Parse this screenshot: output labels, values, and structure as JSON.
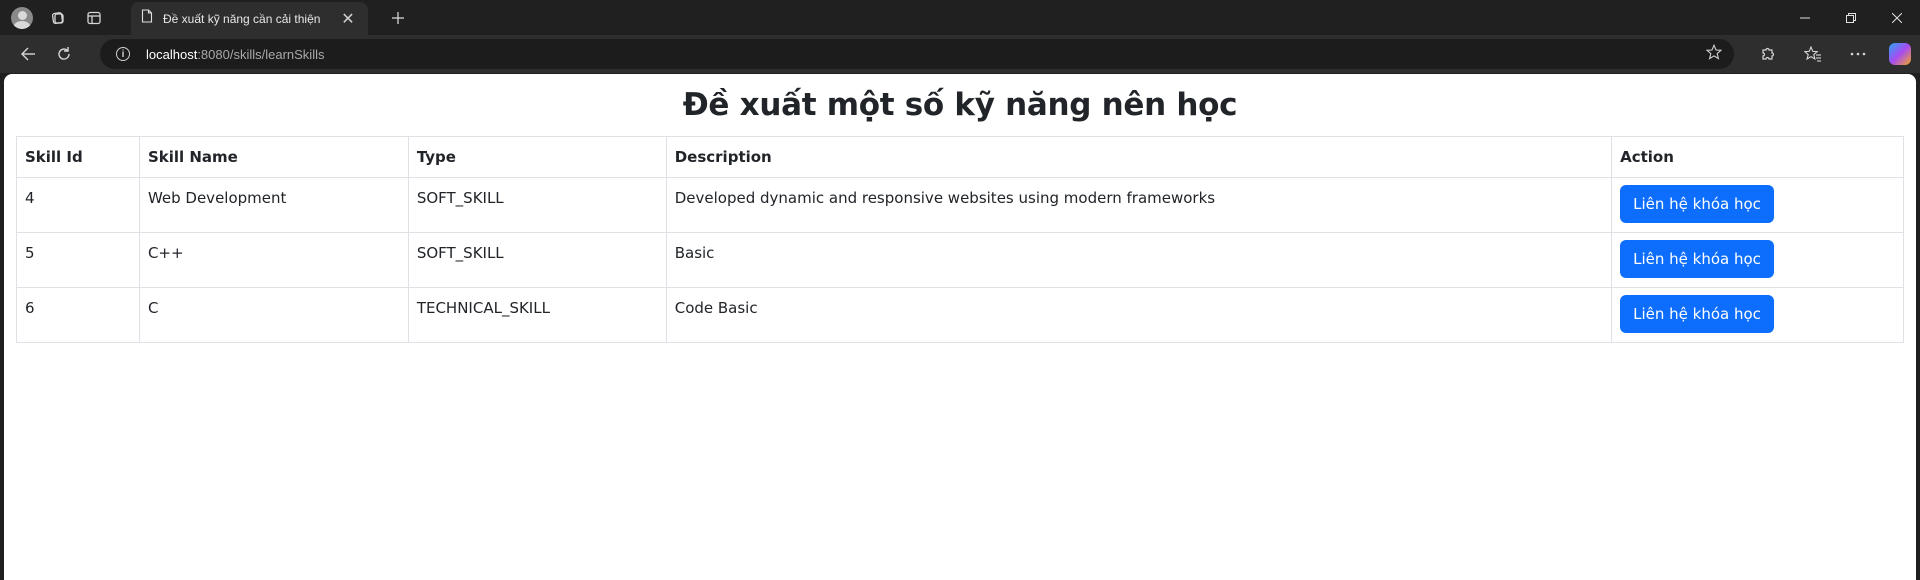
{
  "browser": {
    "tab": {
      "title": "Đề xuất kỹ năng cần cải thiện"
    },
    "address": {
      "host": "localhost",
      "path": ":8080/skills/learnSkills"
    }
  },
  "page": {
    "title": "Đề xuất một số kỹ năng nên học",
    "table": {
      "headers": [
        "Skill Id",
        "Skill Name",
        "Type",
        "Description",
        "Action"
      ],
      "rows": [
        {
          "id": "4",
          "name": "Web Development",
          "type": "SOFT_SKILL",
          "description": "Developed dynamic and responsive websites using modern frameworks",
          "action": "Liên hệ khóa học"
        },
        {
          "id": "5",
          "name": "C++",
          "type": "SOFT_SKILL",
          "description": "Basic",
          "action": "Liên hệ khóa học"
        },
        {
          "id": "6",
          "name": "C",
          "type": "TECHNICAL_SKILL",
          "description": "Code Basic",
          "action": "Liên hệ khóa học"
        }
      ]
    }
  },
  "icons": {
    "profile": "profile-icon",
    "workspaces": "workspaces-icon",
    "tab_actions": "tab-actions-icon",
    "page": "page-icon",
    "close": "close-icon",
    "new_tab": "plus-icon",
    "back": "back-arrow-icon",
    "refresh": "refresh-icon",
    "info": "info-icon",
    "favorite": "star-icon",
    "extensions": "puzzle-icon",
    "favorites": "favorites-icon",
    "menu": "more-icon",
    "copilot": "copilot-icon"
  },
  "colors": {
    "primary_button": "#0d6efd",
    "text": "#212529",
    "border": "#dee2e6"
  }
}
